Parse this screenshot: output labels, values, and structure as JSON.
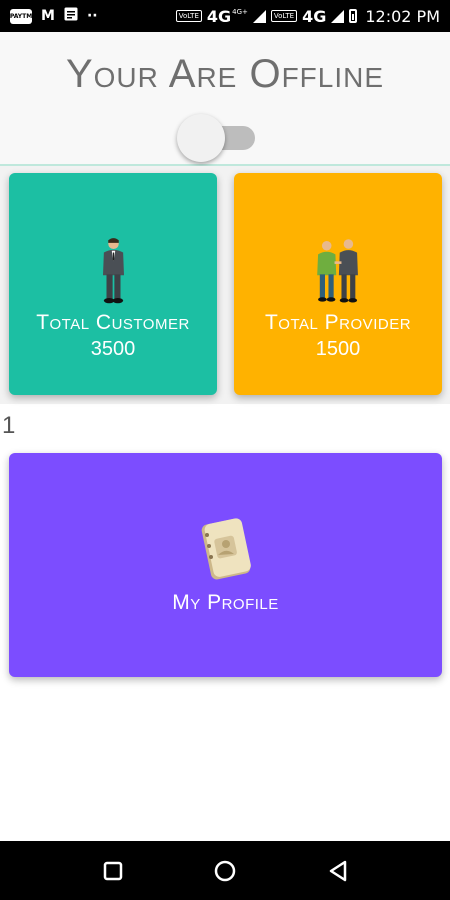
{
  "status_bar": {
    "app_badge": "PAYTM",
    "network_1": "4G",
    "network_1_sup": "4G+",
    "network_2": "4G",
    "volte_1": "VoLTE",
    "volte_2": "VoLTE",
    "time": "12:02 PM",
    "icons": [
      "paytm-icon",
      "gmail-icon",
      "notes-icon",
      "dots-icon",
      "signal-icon",
      "battery-icon"
    ]
  },
  "header": {
    "title": "Your Are Offline",
    "toggle_on": false
  },
  "cards": {
    "customer": {
      "label": "Total Customer",
      "value": "3500",
      "color": "#1cbfa3"
    },
    "provider": {
      "label": "Total Provider",
      "value": "1500",
      "color": "#ffb200"
    },
    "profile": {
      "label": "My Profile",
      "color": "#7c4dff"
    }
  },
  "counter": "1",
  "nav": {
    "buttons": [
      "recents-button",
      "home-button",
      "back-button"
    ]
  }
}
